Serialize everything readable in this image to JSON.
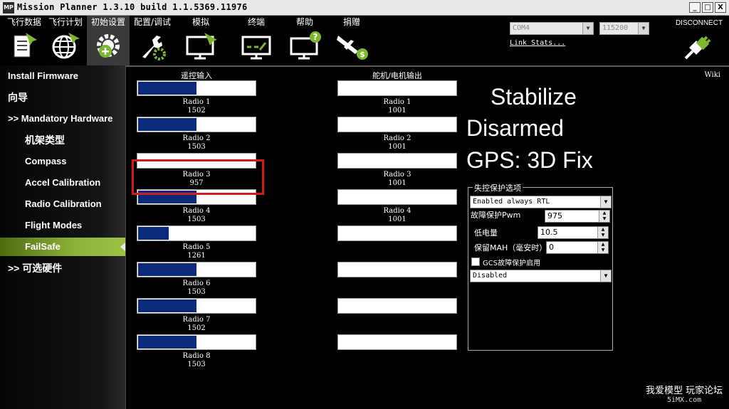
{
  "window": {
    "title": "Mission Planner 1.3.10 build 1.1.5369.11976",
    "icon_text": "MP",
    "min_glyph": "_",
    "max_glyph": "□",
    "close_glyph": "X"
  },
  "toolbar": {
    "items": [
      {
        "label": "飞行数据",
        "icon": "flight-data-icon"
      },
      {
        "label": "飞行计划",
        "icon": "globe-icon"
      },
      {
        "label": "初始设置",
        "icon": "gear-icon"
      },
      {
        "label": "配置/调试",
        "icon": "wrench-gear-icon"
      },
      {
        "label": "模拟",
        "icon": "monitor-plane-icon"
      },
      {
        "label": "终端",
        "icon": "terminal-icon"
      },
      {
        "label": "帮助",
        "icon": "help-monitor-icon"
      },
      {
        "label": "捐赠",
        "icon": "donate-plane-icon"
      }
    ],
    "port_value": "COM4",
    "baud_value": "115200",
    "link_stats": "Link Stats...",
    "disconnect_label": "DISCONNECT",
    "combo_arrow": "▼"
  },
  "sidebar": {
    "items": [
      {
        "label": "Install Firmware"
      },
      {
        "label": "向导"
      },
      {
        "label": ">> Mandatory Hardware"
      },
      {
        "label": "机架类型"
      },
      {
        "label": "Compass"
      },
      {
        "label": "Accel Calibration"
      },
      {
        "label": "Radio Calibration"
      },
      {
        "label": "Flight Modes"
      },
      {
        "label": "FailSafe"
      },
      {
        "label": ">> 可选硬件"
      }
    ],
    "active_index": 8
  },
  "main": {
    "wiki": "Wiki",
    "rc_input_header": "遥控输入",
    "servo_output_header": "舵机/电机输出",
    "radios_in": [
      {
        "name": "Radio 1",
        "value": "1502",
        "fill": 0.5
      },
      {
        "name": "Radio 2",
        "value": "1503",
        "fill": 0.5
      },
      {
        "name": "Radio 3",
        "value": "957",
        "fill": 0.0
      },
      {
        "name": "Radio 4",
        "value": "1503",
        "fill": 0.5
      },
      {
        "name": "Radio 5",
        "value": "1261",
        "fill": 0.26
      },
      {
        "name": "Radio 6",
        "value": "1503",
        "fill": 0.5
      },
      {
        "name": "Radio 7",
        "value": "1502",
        "fill": 0.5
      },
      {
        "name": "Radio 8",
        "value": "1503",
        "fill": 0.5
      }
    ],
    "radios_out": [
      {
        "name": "Radio 1",
        "value": "1001"
      },
      {
        "name": "Radio 2",
        "value": "1001"
      },
      {
        "name": "Radio 3",
        "value": "1001"
      },
      {
        "name": "Radio 4",
        "value": "1001"
      },
      {
        "name": "",
        "value": ""
      },
      {
        "name": "",
        "value": ""
      },
      {
        "name": "",
        "value": ""
      },
      {
        "name": "",
        "value": ""
      }
    ],
    "status": {
      "mode": "Stabilize",
      "armed": "Disarmed",
      "gps": "GPS: 3D Fix"
    },
    "failsafe": {
      "group_title": "失控保护选项",
      "throttle_option": "Enabled always RTL",
      "pwm_label": "故障保护Pwm",
      "pwm_value": "975",
      "low_batt_label": "低电量",
      "low_batt_value": "10.5",
      "reserve_mah_label": "保留MAH（毫安时）",
      "reserve_mah_value": "0",
      "gcs_label": "GCS故障保护启用",
      "gcs_checked": false,
      "gcs_option": "Disabled",
      "spin_up": "▲",
      "spin_down": "▼"
    }
  },
  "watermark": {
    "line1": "我爱模型 玩家论坛",
    "line2": "5iMX.com"
  },
  "colors": {
    "bar_fill": "#0b2a7c",
    "active_green": "#8db23a",
    "highlight_red": "#d21c1c"
  }
}
